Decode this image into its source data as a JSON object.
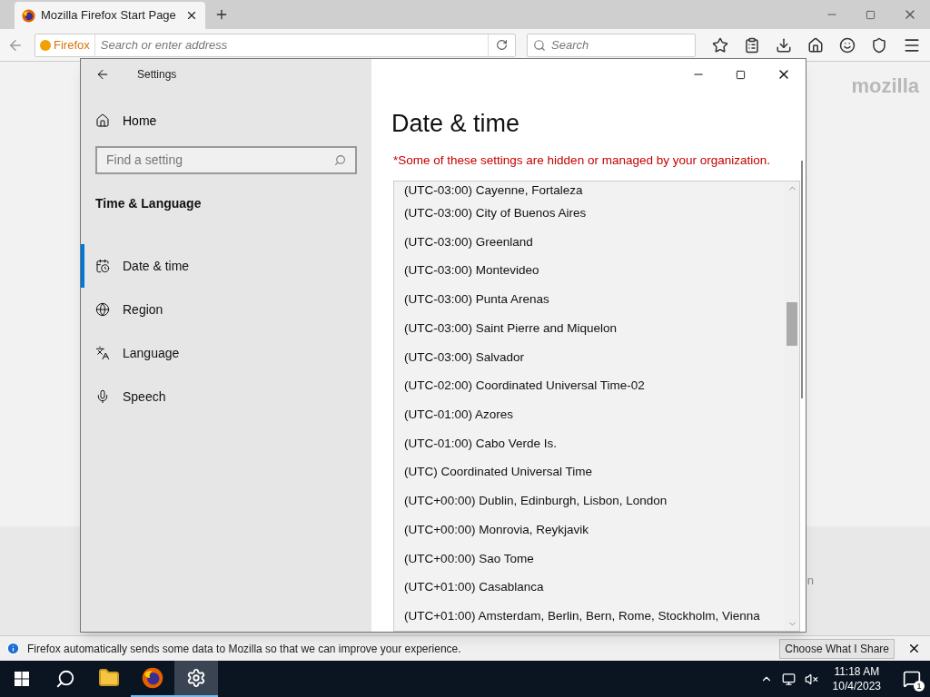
{
  "browser": {
    "tab_title": "Mozilla Firefox Start Page",
    "identity": "Firefox",
    "address_placeholder": "Search or enter address",
    "search_placeholder": "Search"
  },
  "page": {
    "logo": "mozilla",
    "footer_fragment": "n"
  },
  "settings": {
    "title": "Settings",
    "home": "Home",
    "search_placeholder": "Find a setting",
    "section": "Time & Language",
    "nav": [
      {
        "kind": "datetime",
        "label": "Date & time",
        "selected": true
      },
      {
        "kind": "region",
        "label": "Region",
        "selected": false
      },
      {
        "kind": "language",
        "label": "Language",
        "selected": false
      },
      {
        "kind": "speech",
        "label": "Speech",
        "selected": false
      }
    ],
    "heading": "Date & time",
    "notice": "*Some of these settings are hidden or managed by your organization.",
    "timezones": [
      "(UTC-03:00) Cayenne, Fortaleza",
      "(UTC-03:00) City of Buenos Aires",
      "(UTC-03:00) Greenland",
      "(UTC-03:00) Montevideo",
      "(UTC-03:00) Punta Arenas",
      "(UTC-03:00) Saint Pierre and Miquelon",
      "(UTC-03:00) Salvador",
      "(UTC-02:00) Coordinated Universal Time-02",
      "(UTC-01:00) Azores",
      "(UTC-01:00) Cabo Verde Is.",
      "(UTC) Coordinated Universal Time",
      "(UTC+00:00) Dublin, Edinburgh, Lisbon, London",
      "(UTC+00:00) Monrovia, Reykjavik",
      "(UTC+00:00) Sao Tome",
      "(UTC+01:00) Casablanca",
      "(UTC+01:00) Amsterdam, Berlin, Bern, Rome, Stockholm, Vienna"
    ]
  },
  "notification": {
    "text": "Firefox automatically sends some data to Mozilla so that we can improve your experience.",
    "button": "Choose What I Share"
  },
  "taskbar": {
    "apps": [
      {
        "kind": "explorer",
        "running": false,
        "active": false
      },
      {
        "kind": "firefox",
        "running": true,
        "active": false
      },
      {
        "kind": "settings",
        "running": true,
        "active": true
      }
    ],
    "time": "11:18 AM",
    "date": "10/4/2023",
    "notification_count": "1"
  }
}
